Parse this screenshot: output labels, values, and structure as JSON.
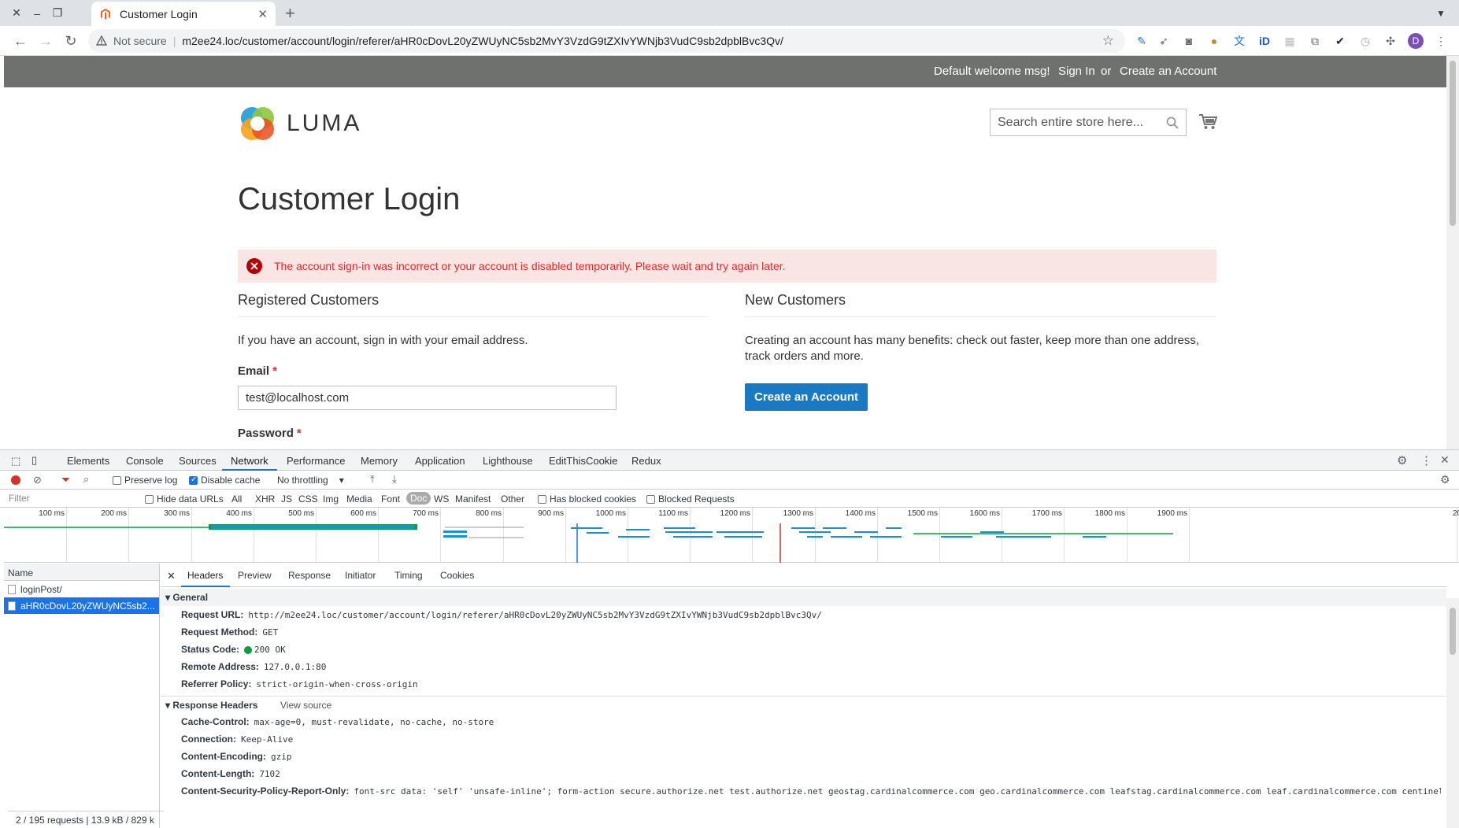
{
  "browser": {
    "tab_title": "Customer Login",
    "not_secure": "Not secure",
    "url": "m2ee24.loc/customer/account/login/referer/aHR0cDovL20yZWUyNC5sb2MvY3VzdG9tZXIvYWNjb3VudC9sb2dpblBvc3Qv/",
    "profile_initial": "D"
  },
  "header": {
    "welcome": "Default welcome msg!",
    "sign_in": "Sign In",
    "or": "or",
    "create_account": "Create an Account"
  },
  "logo_text": "LUMA",
  "search": {
    "placeholder": "Search entire store here..."
  },
  "page_title": "Customer Login",
  "error_message": "The account sign-in was incorrect or your account is disabled temporarily. Please wait and try again later.",
  "registered": {
    "title": "Registered Customers",
    "intro": "If you have an account, sign in with your email address.",
    "email_label": "Email",
    "email_value": "test@localhost.com",
    "password_label": "Password",
    "required_mark": "*"
  },
  "new_customers": {
    "title": "New Customers",
    "text": "Creating an account has many benefits: check out faster, keep more than one address, track orders and more.",
    "button": "Create an Account"
  },
  "devtools": {
    "tabs": [
      "Elements",
      "Console",
      "Sources",
      "Network",
      "Performance",
      "Memory",
      "Application",
      "Lighthouse",
      "EditThisCookie",
      "Redux"
    ],
    "active_tab": "Network",
    "preserve_log": "Preserve log",
    "disable_cache": "Disable cache",
    "throttling": "No throttling",
    "filter_placeholder": "Filter",
    "hide_data_urls": "Hide data URLs",
    "types": [
      "All",
      "XHR",
      "JS",
      "CSS",
      "Img",
      "Media",
      "Font",
      "Doc",
      "WS",
      "Manifest",
      "Other"
    ],
    "active_type": "Doc",
    "has_blocked_cookies": "Has blocked cookies",
    "blocked_requests": "Blocked Requests",
    "ticks": [
      "100 ms",
      "200 ms",
      "300 ms",
      "400 ms",
      "500 ms",
      "600 ms",
      "700 ms",
      "800 ms",
      "900 ms",
      "1000 ms",
      "1100 ms",
      "1200 ms",
      "1300 ms",
      "1400 ms",
      "1500 ms",
      "1600 ms",
      "1700 ms",
      "1800 ms",
      "1900 ms",
      "20"
    ],
    "name_header": "Name",
    "requests": [
      "loginPost/",
      "aHR0cDovL20yZWUyNC5sb2..."
    ],
    "footer": "2 / 195 requests  |  13.9 kB / 829 k",
    "detail_tabs": [
      "Headers",
      "Preview",
      "Response",
      "Initiator",
      "Timing",
      "Cookies"
    ],
    "general_title": "General",
    "general": [
      {
        "k": "Request URL:",
        "v": "http://m2ee24.loc/customer/account/login/referer/aHR0cDovL20yZWUyNC5sb2MvY3VzdG9tZXIvYWNjb3VudC9sb2dpblBvc3Qv/"
      },
      {
        "k": "Request Method:",
        "v": "GET"
      },
      {
        "k": "Status Code:",
        "v": "200 OK"
      },
      {
        "k": "Remote Address:",
        "v": "127.0.0.1:80"
      },
      {
        "k": "Referrer Policy:",
        "v": "strict-origin-when-cross-origin"
      }
    ],
    "response_title": "Response Headers",
    "view_source": "View source",
    "response": [
      {
        "k": "Cache-Control:",
        "v": "max-age=0, must-revalidate, no-cache, no-store"
      },
      {
        "k": "Connection:",
        "v": "Keep-Alive"
      },
      {
        "k": "Content-Encoding:",
        "v": "gzip"
      },
      {
        "k": "Content-Length:",
        "v": "7102"
      },
      {
        "k": "Content-Security-Policy-Report-Only:",
        "v": "font-src data: 'self' 'unsafe-inline'; form-action secure.authorize.net test.authorize.net geostag.cardinalcommerce.com geo.cardinalcommerce.com leafstag.cardinalcommerce.com leaf.cardinalcommerce.com centinel"
      }
    ]
  }
}
